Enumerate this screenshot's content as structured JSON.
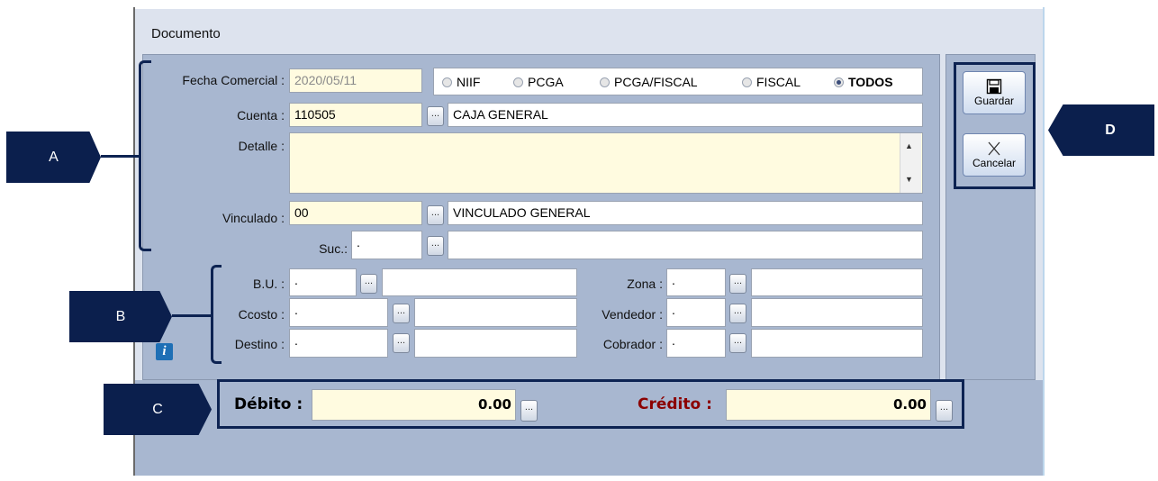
{
  "window": {
    "title": "Documento"
  },
  "form": {
    "fecha_label": "Fecha Comercial :",
    "fecha_value": "2020/05/11",
    "radios": [
      {
        "label": "NIIF",
        "selected": false
      },
      {
        "label": "PCGA",
        "selected": false
      },
      {
        "label": "PCGA/FISCAL",
        "selected": false
      },
      {
        "label": "FISCAL",
        "selected": false
      },
      {
        "label": "TODOS",
        "selected": true
      }
    ],
    "cuenta_label": "Cuenta :",
    "cuenta_code": "110505",
    "cuenta_name": "CAJA GENERAL",
    "detalle_label": "Detalle :",
    "detalle_value": "",
    "vinculado_label": "Vinculado :",
    "vinculado_code": "00",
    "vinculado_name": "VINCULADO GENERAL",
    "suc_label": "Suc.:",
    "suc_value": ".",
    "bu_label": "B.U. :",
    "bu_value": ".",
    "ccosto_label": "Ccosto :",
    "ccosto_value": ".",
    "destino_label": "Destino :",
    "destino_value": ".",
    "zona_label": "Zona :",
    "zona_value": ".",
    "vendedor_label": "Vendedor :",
    "vendedor_value": ".",
    "cobrador_label": "Cobrador :",
    "cobrador_value": "."
  },
  "buttons": {
    "lookup": "...",
    "guardar": "Guardar",
    "cancelar": "Cancelar"
  },
  "totals": {
    "debito_label": "Débito :",
    "debito_value": "0.00",
    "credito_label": "Crédito :",
    "credito_value": "0.00"
  },
  "callouts": {
    "a": "A",
    "b": "B",
    "c": "C",
    "d": "D"
  },
  "icons": {
    "info": "i",
    "scroll_up": "▲",
    "scroll_down": "▼"
  },
  "colors": {
    "panel": "#a8b7d0",
    "field_yellow": "#fffbe0",
    "callout": "#0b1f4d",
    "credito": "#8b0000"
  }
}
